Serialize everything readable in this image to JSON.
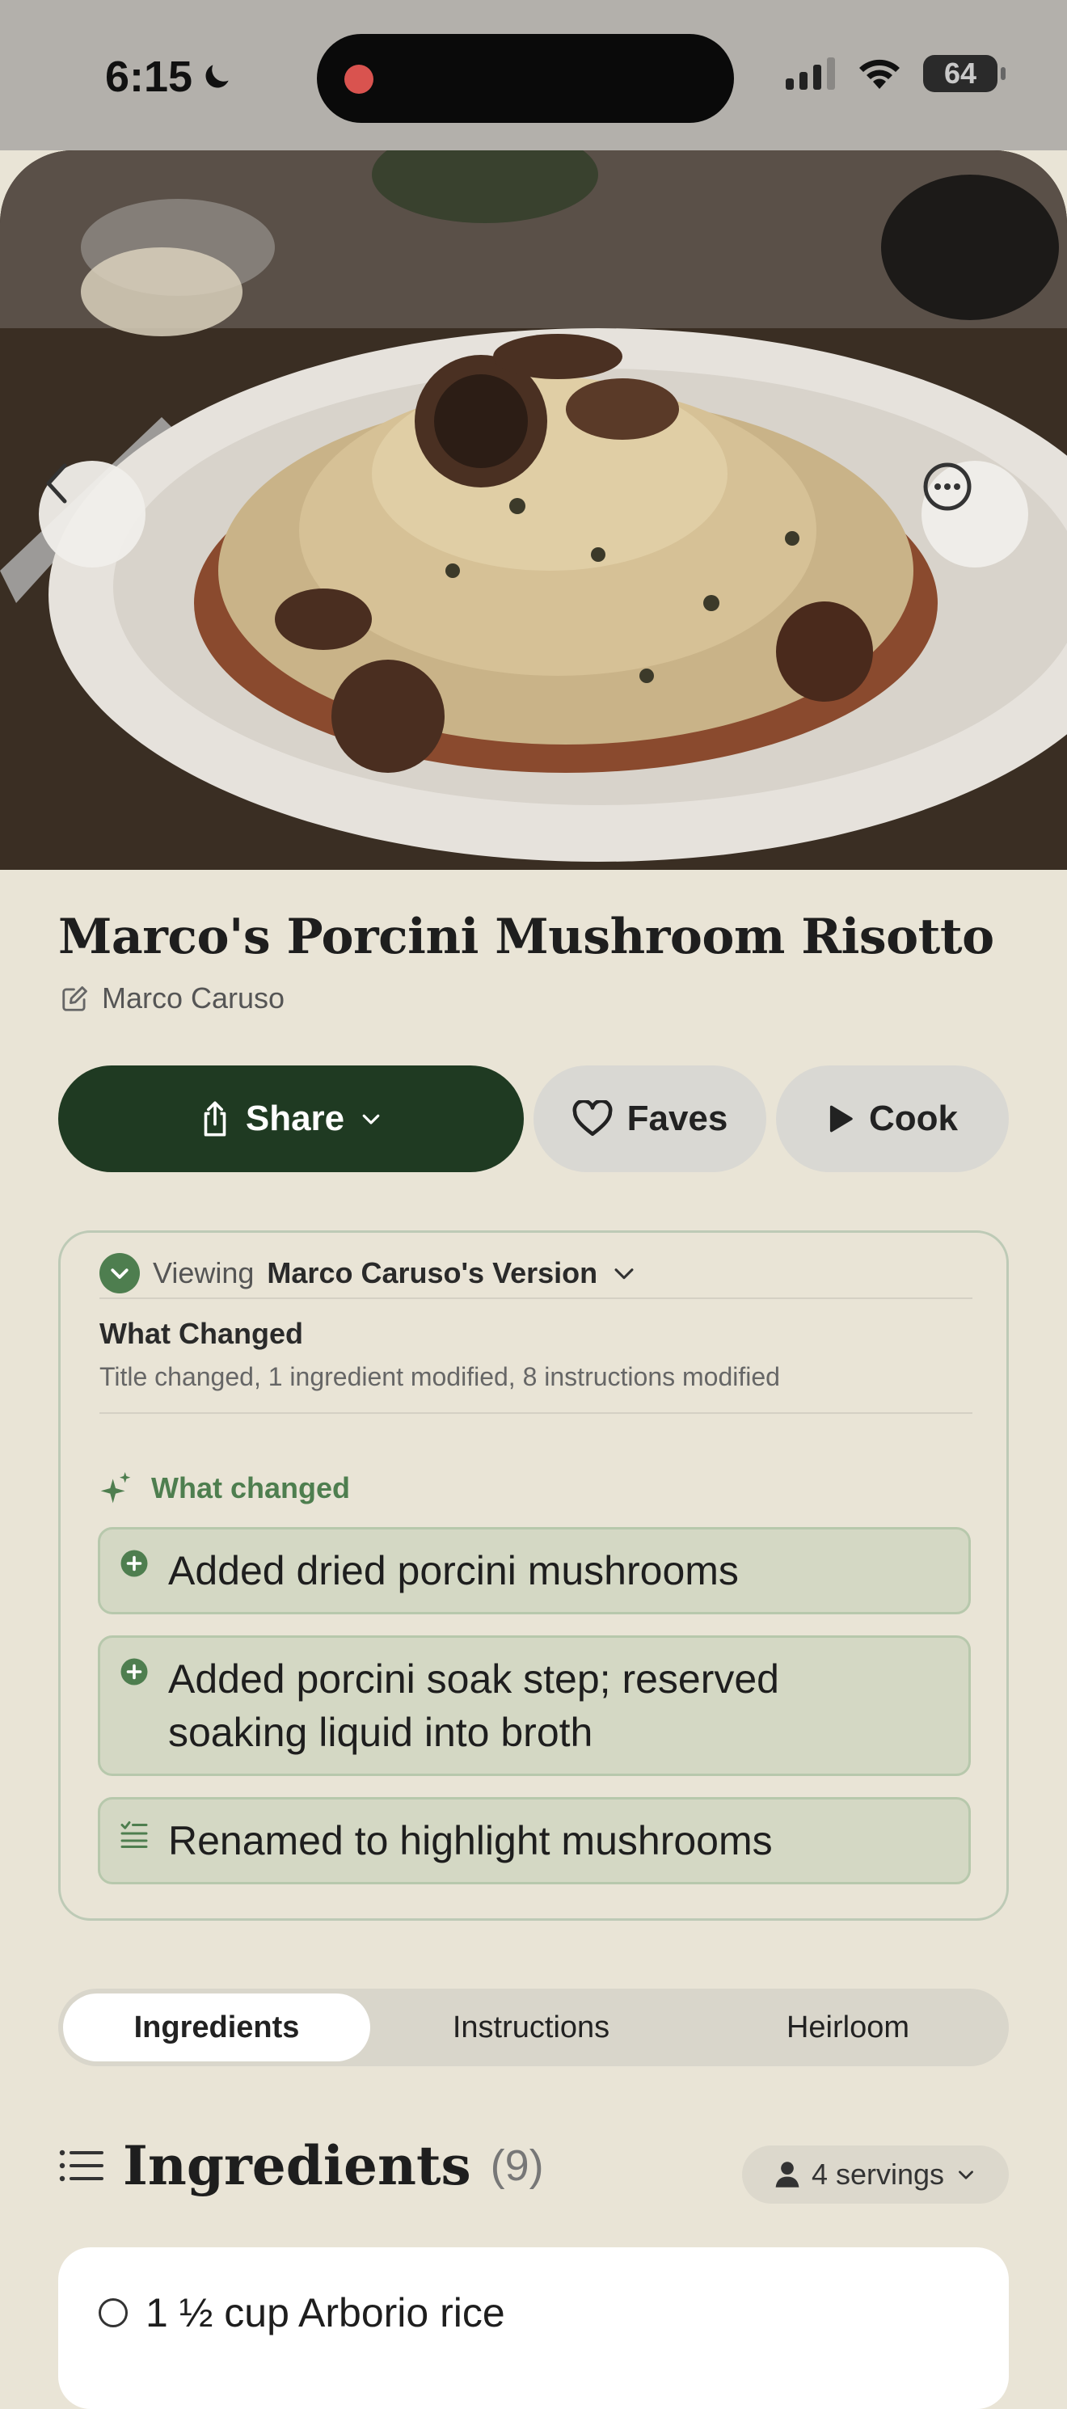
{
  "status_bar": {
    "time": "6:15",
    "battery": "64"
  },
  "hero": {
    "image_alt": "Porcini mushroom risotto on a white plate"
  },
  "recipe": {
    "title": "Marco's Porcini Mushroom Risotto",
    "author": "Marco Caruso"
  },
  "actions": {
    "share": "Share",
    "faves": "Faves",
    "cook": "Cook"
  },
  "version": {
    "viewing_prefix": "Viewing",
    "viewing_name": "Marco Caruso's Version",
    "what_changed_heading": "What Changed",
    "summary": "Title changed, 1 ingredient modified, 8 instructions modified",
    "ai_heading": "What changed",
    "changes": [
      {
        "text": "Added dried porcini mushrooms",
        "icon": "plus-circle-icon"
      },
      {
        "text": "Added porcini soak step; reserved soaking liquid into broth",
        "icon": "plus-circle-icon"
      },
      {
        "text": "Renamed to highlight mushrooms",
        "icon": "list-check-icon"
      }
    ]
  },
  "tabs": {
    "ingredients": "Ingredients",
    "instructions": "Instructions",
    "heirloom": "Heirloom",
    "selected": "Ingredients"
  },
  "ingredients": {
    "heading": "Ingredients",
    "count": "(9)",
    "servings": "4 servings",
    "items": [
      {
        "text": "1 ½ cup Arborio rice"
      }
    ]
  },
  "colors": {
    "accent": "#1f3a22",
    "green": "#4e7e4f",
    "background": "#e9e4d6"
  }
}
